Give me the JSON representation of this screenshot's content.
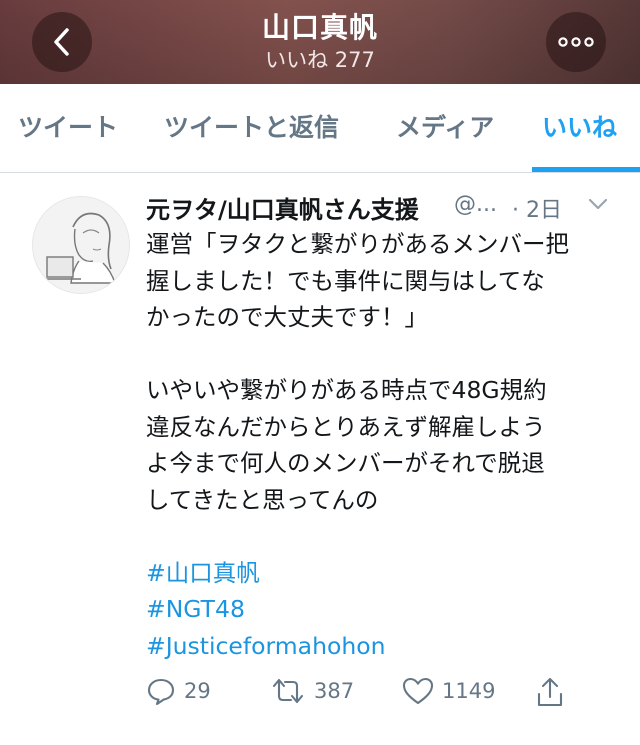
{
  "header": {
    "title": "山口真帆",
    "subtitle": "いいね 277",
    "back_icon": "chevron-left-icon",
    "more_icon": "more-dots-icon"
  },
  "tabs": [
    {
      "label": "ツイート",
      "active": false
    },
    {
      "label": "ツイートと返信",
      "active": false
    },
    {
      "label": "メディア",
      "active": false
    },
    {
      "label": "いいね",
      "active": true
    }
  ],
  "tweet": {
    "author": "元ヲタ/山口真帆さん支援",
    "handle": "@...",
    "time": "· 2日",
    "lines": [
      "運営「ヲタクと繋がりがあるメンバー把",
      "握しました！でも事件に関与はしてな",
      "かったので大丈夫です！」",
      "いやいや繋がりがある時点で48G規約",
      "違反なんだからとりあえず解雇しよう",
      "よ今まで何人のメンバーがそれで脱退",
      "してきたと思ってんの"
    ],
    "hashtags": [
      "#山口真帆",
      "#NGT48",
      "#Justiceformahohon"
    ],
    "replies": "29",
    "retweets": "387",
    "likes": "1149"
  },
  "colors": {
    "accent": "#1da1f2",
    "hashtag": "#1b95e0",
    "muted": "#657786"
  }
}
